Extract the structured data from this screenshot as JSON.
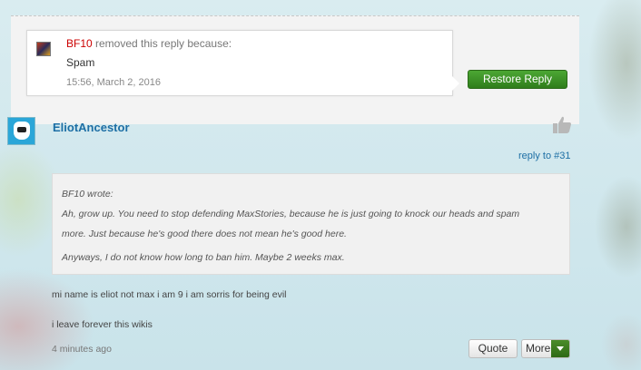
{
  "removed_notice": {
    "user": "BF10",
    "text": "removed this reply because:",
    "reason": "Spam",
    "timestamp": "15:56, March 2, 2016",
    "restore_label": "Restore Reply"
  },
  "reply": {
    "username": "EliotAncestor",
    "reply_to": "reply to #31",
    "quote": {
      "author_line": "BF10 wrote:",
      "lines": [
        "Ah, grow up. You need to stop defending MaxStories, because he is just going to knock our heads and spam",
        "more. Just because he's good there does not mean he's good here.",
        "Anyways, I do not know how long to ban him. Maybe 2 weeks max."
      ]
    },
    "body": [
      "mi name is eliot not max i am 9 i am sorris for being evil",
      "i leave forever this wikis"
    ],
    "timestamp": "4 minutes ago",
    "quote_label": "Quote",
    "more_label": "More"
  },
  "icons": {
    "like": "thumbs-up-icon",
    "caret": "chevron-down-icon"
  },
  "colors": {
    "link": "#1d6fa5",
    "removed_user": "#cc0000",
    "restore_button": "#3a8f25"
  }
}
